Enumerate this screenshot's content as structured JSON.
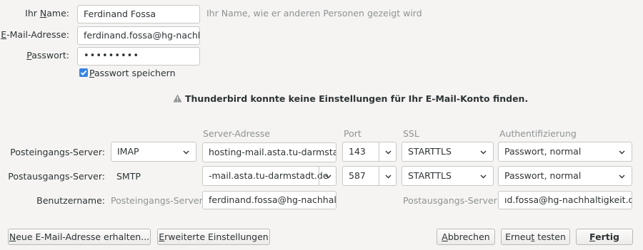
{
  "identity": {
    "name_label_pre": "Ihr ",
    "name_label_u": "N",
    "name_label_post": "ame:",
    "name_value": "Ferdinand Fossa",
    "name_hint": "Ihr Name, wie er anderen Personen gezeigt wird",
    "email_label_u": "E",
    "email_label_post": "-Mail-Adresse:",
    "email_value": "ferdinand.fossa@hg-nachha",
    "password_label_u": "P",
    "password_label_post": "asswort:",
    "password_value": "•••••••••",
    "remember_u": "P",
    "remember_post": "asswort speichern",
    "remember_checked": true
  },
  "warning": {
    "icon": "warning-icon",
    "text": "Thunderbird konnte keine Einstellungen für Ihr E-Mail-Konto finden."
  },
  "headers": {
    "server": "Server-Adresse",
    "port": "Port",
    "ssl": "SSL",
    "auth": "Authentifizierung"
  },
  "incoming": {
    "label": "Posteingangs-Server:",
    "protocol": "IMAP",
    "server": "hosting-mail.asta.tu-darmstadt",
    "port": "143",
    "ssl": "STARTTLS",
    "auth": "Passwort, normal"
  },
  "outgoing": {
    "label": "Postausgangs-Server:",
    "protocol": "SMTP",
    "server": "-mail.asta.tu-darmstadt.de",
    "port": "587",
    "ssl": "STARTTLS",
    "auth": "Passwort, normal"
  },
  "username": {
    "label": "Benutzername:",
    "in_label": "Posteingangs-Server:",
    "in_value": "ferdinand.fossa@hg-nachhaltig",
    "out_label": "Postausgangs-Server:",
    "out_value": "ıd.fossa@hg-nachhaltigkeit.de"
  },
  "buttons": {
    "new_address_u": "N",
    "new_address_post": "eue E-Mail-Adresse erhalten...",
    "advanced_u": "E",
    "advanced_post": "rweiterte Einstellungen",
    "cancel_u": "A",
    "cancel_post": "bbrechen",
    "retest_pre": "Erneu",
    "retest_u": "t",
    "retest_post": " testen",
    "done_u": "F",
    "done_post": "ertig"
  }
}
